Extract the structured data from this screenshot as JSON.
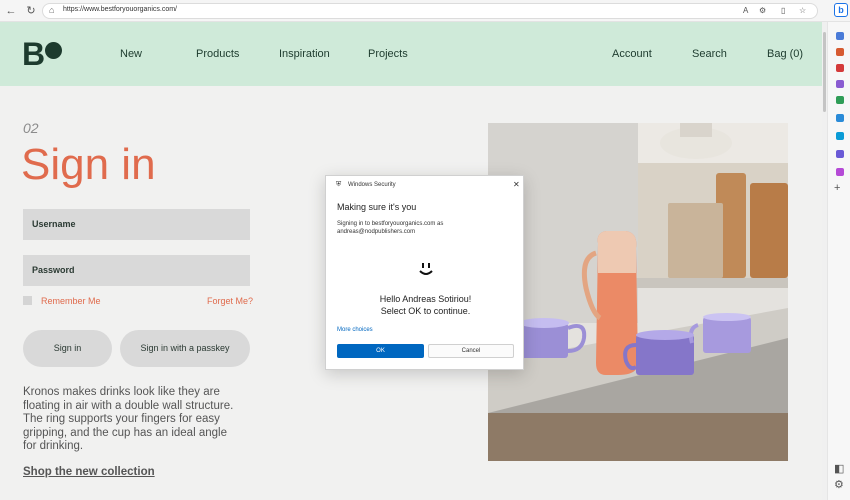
{
  "browser": {
    "url": "https://www.bestforyouorganics.com/",
    "back_icon": "back-arrow-icon",
    "refresh_icon": "refresh-icon"
  },
  "header": {
    "logo": "B",
    "nav_left": [
      "New",
      "Products",
      "Inspiration",
      "Projects"
    ],
    "nav_right": [
      "Account",
      "Search",
      "Bag (0)"
    ]
  },
  "signin": {
    "step": "02",
    "title": "Sign in",
    "username_label": "Username",
    "password_label": "Password",
    "remember_label": "Remember Me",
    "forget_label": "Forget Me?",
    "signin_button": "Sign in",
    "passkey_button": "Sign in with a passkey",
    "promo_text": "Kronos makes drinks look like they are floating in air with a double wall structure. The ring supports your fingers for easy gripping, and the cup has an ideal angle for drinking.",
    "shop_link": "Shop the new collection"
  },
  "dialog": {
    "title": "Windows Security",
    "heading": "Making sure it's you",
    "info_line1": "Signing in to bestforyouorganics.com as",
    "info_line2": "andreas@nodpublishers.com",
    "hello": "Hello Andreas Sotiriou!",
    "instruction": "Select OK to continue.",
    "more_choices": "More choices",
    "ok": "OK",
    "cancel": "Cancel"
  },
  "colors": {
    "header_bg": "#cfead9",
    "accent": "#e06b4d",
    "brand_dark": "#1d3b2e",
    "dialog_primary": "#0067c0"
  }
}
